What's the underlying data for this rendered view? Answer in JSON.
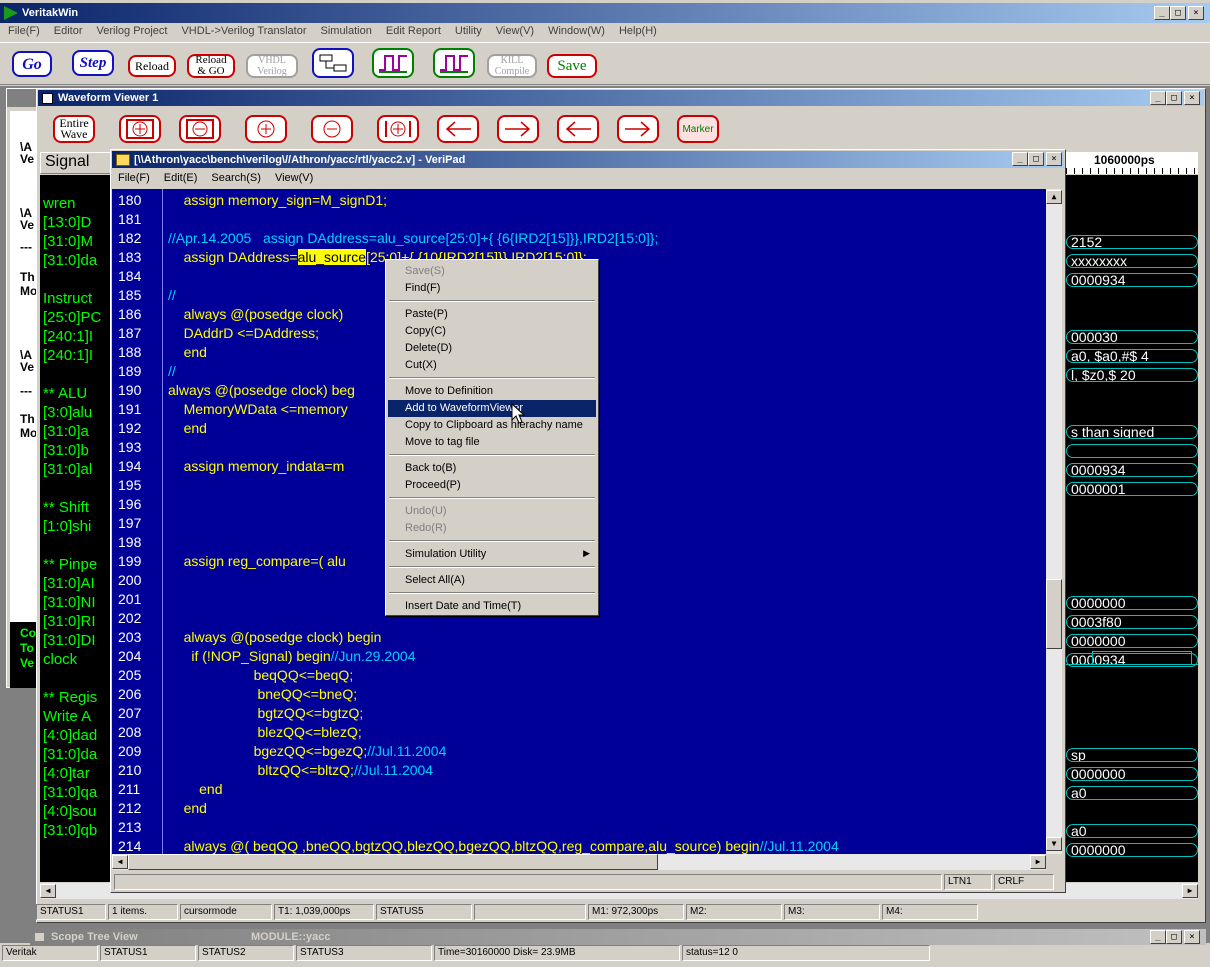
{
  "app": {
    "title": "VeritakWin",
    "menu": [
      "File(F)",
      "Editor",
      "Verilog Project",
      "VHDL->Verilog Translator",
      "Simulation",
      "Edit Report",
      "Utility",
      "View(V)",
      "Window(W)",
      "Help(H)"
    ],
    "toolbar": {
      "go": "Go",
      "step": "Step",
      "reload": "Reload",
      "reload_go_1": "Reload",
      "reload_go_2": "& GO",
      "vhdl_1": "VHDL",
      "vhdl_2": "Verilog",
      "kill_1": "KILL",
      "kill_2": "Compile",
      "save": "Save"
    }
  },
  "waveform": {
    "title": "Waveform Viewer 1",
    "entire_wave_1": "Entire",
    "entire_wave_2": "Wave",
    "marker": "Marker",
    "signal_header": "Signal",
    "time_label": "1060000ps",
    "signals": [
      "wren",
      "[13:0]D",
      "[31:0]M",
      "[31:0]da",
      "",
      "Instruct",
      "[25:0]PC",
      "[240:1]I",
      "[240:1]I",
      "",
      "** ALU",
      "[3:0]alu",
      "[31:0]a",
      "[31:0]b",
      "[31:0]al",
      "",
      "** Shift",
      "[1:0]shi",
      "",
      "** Pinpe",
      "[31:0]AI",
      "[31:0]NI",
      "[31:0]RI",
      "[31:0]DI",
      "clock",
      "",
      "** Regis",
      " Write A",
      "[4:0]dad",
      "[31:0]da",
      "[4:0]tar",
      "[31:0]qa",
      "[4:0]sou",
      "[31:0]qb"
    ],
    "values": [
      {
        "row": 1,
        "text": "2152"
      },
      {
        "row": 2,
        "text": "xxxxxxxx"
      },
      {
        "row": 3,
        "text": "0000934"
      },
      {
        "row": 6,
        "text": "000030"
      },
      {
        "row": 7,
        "text": "a0, $a0,#$   4"
      },
      {
        "row": 8,
        "text": "l, $z0,$     20"
      },
      {
        "row": 11,
        "text": "s than signed"
      },
      {
        "row": 12,
        "text": ""
      },
      {
        "row": 13,
        "text": "0000934"
      },
      {
        "row": 14,
        "text": "0000001"
      },
      {
        "row": 20,
        "text": "0000000"
      },
      {
        "row": 21,
        "text": "0003f80"
      },
      {
        "row": 22,
        "text": "0000000"
      },
      {
        "row": 23,
        "text": "0000934"
      },
      {
        "row": 28,
        "text": "sp"
      },
      {
        "row": 29,
        "text": "0000000"
      },
      {
        "row": 30,
        "text": "a0"
      },
      {
        "row": 32,
        "text": "a0"
      },
      {
        "row": 33,
        "text": "0000000"
      }
    ],
    "status": [
      "STATUS1",
      "1 items.",
      "cursormode",
      "T1: 1,039,000ps",
      "STATUS5",
      "",
      "M1: 972,300ps",
      "M2:",
      "M3:",
      "M4:"
    ]
  },
  "left_panel": {
    "items": [
      "\\A",
      "Ve",
      "\\A",
      "Ve",
      "---",
      "Th",
      "Mo",
      "\\A",
      "Ve",
      "---",
      "Th",
      "Mo"
    ],
    "bottom_items": [
      "Co",
      "To",
      "Ve"
    ]
  },
  "veripad": {
    "title": "[\\\\Athron\\yacc\\bench\\verilog\\//Athron/yacc/rtl/yacc2.v] - VeriPad",
    "menu": [
      "File(F)",
      "Edit(E)",
      "Search(S)",
      "View(V)"
    ],
    "status_line": "LTN1",
    "status_eol": "CRLF",
    "lines": [
      {
        "n": "180",
        "html": "    <span class='kw'>assign memory_sign=M_signD1;</span>"
      },
      {
        "n": "181",
        "html": ""
      },
      {
        "n": "182",
        "html": "<span class='cm'>//Apr.14.2005   assign DAddress=alu_source[25:0]+{ {6{IRD2[15]}},IRD2[15:0]};</span>"
      },
      {
        "n": "183",
        "html": "    <span class='kw'>assign DAddress=</span><span style='background:#ffff00;color:#000'>alu_source</span><span class='kw'>[25:0]+{ {10{IRD2[15]}},IRD2[15:0]};</span>"
      },
      {
        "n": "184",
        "html": ""
      },
      {
        "n": "185",
        "html": "<span class='cm'>//</span>"
      },
      {
        "n": "186",
        "html": "    <span class='kw'>always @(posedge clock)</span>"
      },
      {
        "n": "187",
        "html": "    <span class='kw'>DAddrD &lt;=DAddress;</span>"
      },
      {
        "n": "188",
        "html": "    <span class='kw'>end</span>"
      },
      {
        "n": "189",
        "html": "<span class='cm'>//</span>"
      },
      {
        "n": "190",
        "html": "<span class='kw'>always @(posedge clock) beg</span>"
      },
      {
        "n": "191",
        "html": "    <span class='kw'>MemoryWData &lt;=memory</span>"
      },
      {
        "n": "192",
        "html": "    <span class='kw'>end</span>"
      },
      {
        "n": "193",
        "html": ""
      },
      {
        "n": "194",
        "html": "    <span class='kw'>assign memory_indata=m</span>"
      },
      {
        "n": "195",
        "html": ""
      },
      {
        "n": "196",
        "html": ""
      },
      {
        "n": "197",
        "html": ""
      },
      {
        "n": "198",
        "html": ""
      },
      {
        "n": "199",
        "html": "    <span class='kw'>assign reg_compare=( alu</span>"
      },
      {
        "n": "200",
        "html": ""
      },
      {
        "n": "201",
        "html": ""
      },
      {
        "n": "202",
        "html": ""
      },
      {
        "n": "203",
        "html": "    <span class='kw'>always @(posedge clock) begin</span>"
      },
      {
        "n": "204",
        "html": "      <span class='kw'>if (!NOP_Signal) begin</span><span class='cm'>//Jun.29.2004</span>"
      },
      {
        "n": "205",
        "html": "                      <span class='kw'>beqQQ&lt;=beqQ;</span>"
      },
      {
        "n": "206",
        "html": "                       <span class='kw'>bneQQ&lt;=bneQ;</span>"
      },
      {
        "n": "207",
        "html": "                       <span class='kw'>bgtzQQ&lt;=bgtzQ;</span>"
      },
      {
        "n": "208",
        "html": "                       <span class='kw'>blezQQ&lt;=blezQ;</span>"
      },
      {
        "n": "209",
        "html": "                      <span class='kw'>bgezQQ&lt;=bgezQ;</span><span class='cm'>//Jul.11.2004</span>"
      },
      {
        "n": "210",
        "html": "                       <span class='kw'>bltzQQ&lt;=bltzQ;</span><span class='cm'>//Jul.11.2004</span>"
      },
      {
        "n": "211",
        "html": "        <span class='kw'>end</span>"
      },
      {
        "n": "212",
        "html": "    <span class='kw'>end</span>"
      },
      {
        "n": "213",
        "html": ""
      },
      {
        "n": "214",
        "html": "    <span class='kw'>always @( beqQQ ,bneQQ,bgtzQQ,blezQQ,bgezQQ,bltzQQ,reg_compare,alu_source) begin</span><span class='cm'>//Jul.11.2004</span>"
      }
    ]
  },
  "context_menu": {
    "groups": [
      [
        {
          "label": "Save(S)",
          "disabled": true
        },
        {
          "label": "Find(F)",
          "disabled": false
        }
      ],
      [
        {
          "label": "Paste(P)",
          "disabled": false
        },
        {
          "label": "Copy(C)",
          "disabled": false
        },
        {
          "label": "Delete(D)",
          "disabled": false
        },
        {
          "label": "Cut(X)",
          "disabled": false
        }
      ],
      [
        {
          "label": "Move to Definition",
          "disabled": false
        },
        {
          "label": "Add to WaveformViewer",
          "disabled": false,
          "selected": true
        },
        {
          "label": "Copy to Clipboard as hierachy name",
          "disabled": false
        },
        {
          "label": "Move to tag file",
          "disabled": false
        }
      ],
      [
        {
          "label": "Back to(B)",
          "disabled": false
        },
        {
          "label": "Proceed(P)",
          "disabled": false
        }
      ],
      [
        {
          "label": "Undo(U)",
          "disabled": true
        },
        {
          "label": "Redo(R)",
          "disabled": true
        }
      ],
      [
        {
          "label": "Simulation Utility",
          "disabled": false,
          "submenu": true
        }
      ],
      [
        {
          "label": "Select All(A)",
          "disabled": false
        }
      ],
      [
        {
          "label": "Insert Date and Time(T)",
          "disabled": false
        }
      ]
    ]
  },
  "scope": {
    "title": "Scope Tree View",
    "module": "MODULE::yacc"
  },
  "statusbar": [
    "Veritak",
    "STATUS1",
    "STATUS2",
    "STATUS3",
    "Time=30160000 Disk= 23.9MB",
    "status=12 0"
  ],
  "colors": {
    "wave_bg": "#000000",
    "signal_fg": "#00ff00",
    "editor_bg": "#000099",
    "keyword": "#ffff00",
    "comment": "#00d0ff",
    "wave_line": "#00c0c0"
  }
}
